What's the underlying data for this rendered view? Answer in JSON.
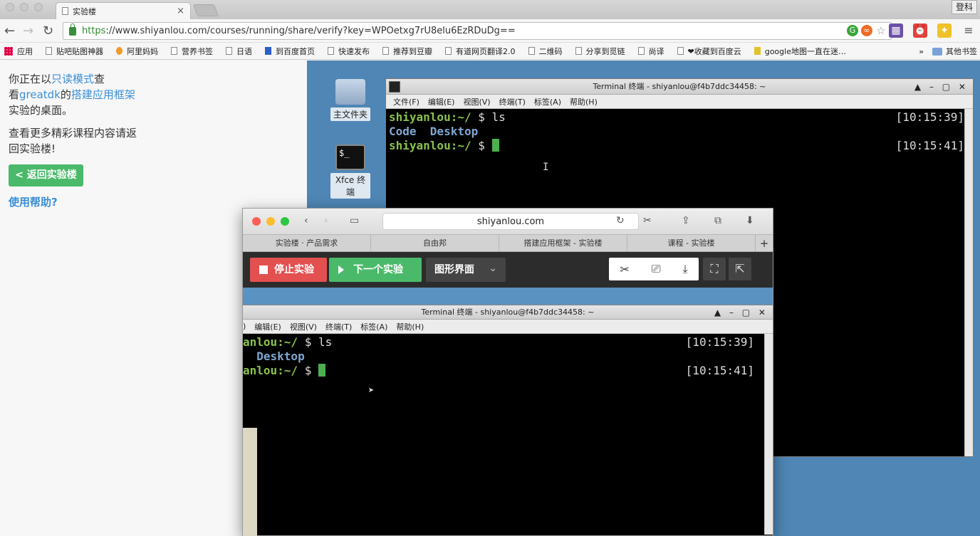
{
  "browser": {
    "tab_title": "实验楼",
    "tab_close": "×",
    "login_button": "登科",
    "url_scheme": "https",
    "url_rest": "://www.shiyanlou.com/courses/running/share/verify?key=WPOetxg7rU8elu6EzRDuDg==",
    "bookmarks": [
      "应用",
      "贴吧贴图神器",
      "阿里妈妈",
      "营养书签",
      "日语",
      "到百度首页",
      "快速发布",
      "推荐到豆瓣",
      "有道网页翻译2.0",
      "二维码",
      "分享到觅链",
      "尚译",
      "❤收藏到百度云",
      "google地图一直在迷…"
    ],
    "bookmarks_more": "»",
    "other_bookmarks": "其他书签"
  },
  "left_panel": {
    "line1_prefix": "你正在以",
    "line1_link": "只读模式",
    "line1_suffix": "查",
    "line2_prefix": "看",
    "line2_user": "greatdk",
    "line2_mid": "的",
    "line2_course": "搭建应用框架",
    "line3": "实验的桌面。",
    "more_line1": "查看更多精彩课程内容请返",
    "more_line2": "回实验楼!",
    "back_button": "< 返回实验楼",
    "help_link": "使用帮助?"
  },
  "desktop": {
    "icon_home": "主文件夹",
    "icon_terminal": "Xfce 终端",
    "terminal_icon_glyph": "$_"
  },
  "terminal": {
    "title": "Terminal 终端 - shiyanlou@f4b7ddc34458: ~",
    "window_buttons": "▲ – ▢ ✕",
    "menu": [
      "文件(F)",
      "编辑(E)",
      "视图(V)",
      "终端(T)",
      "标签(A)",
      "帮助(H)"
    ],
    "prompt": "shiyanlou:~/",
    "dollar": "$",
    "command": "ls",
    "output_code": "Code",
    "output_desktop": "Desktop",
    "time1": "[10:15:39]",
    "time2": "[10:15:41]"
  },
  "safari": {
    "address": "shiyanlou.com",
    "tabs": [
      "实验楼 · 产品需求",
      "自由邦",
      "搭建应用框架 - 实验楼",
      "课程 - 实验楼"
    ],
    "new_tab": "+",
    "stop_button": "停止实验",
    "next_button": "下一个实验",
    "mode_select": "图形界面",
    "mode_chevron": "⌄"
  },
  "inner_terminal": {
    "menu": [
      "编辑(E)",
      "视图(V)",
      "终端(T)",
      "标签(A)",
      "帮助(H)"
    ],
    "menu_cut": ")",
    "prompt": "anlou:~/",
    "dollar": "$",
    "command": "ls",
    "output_desktop": "Desktop",
    "time1": "[10:15:39]",
    "time2": "[10:15:41]"
  }
}
